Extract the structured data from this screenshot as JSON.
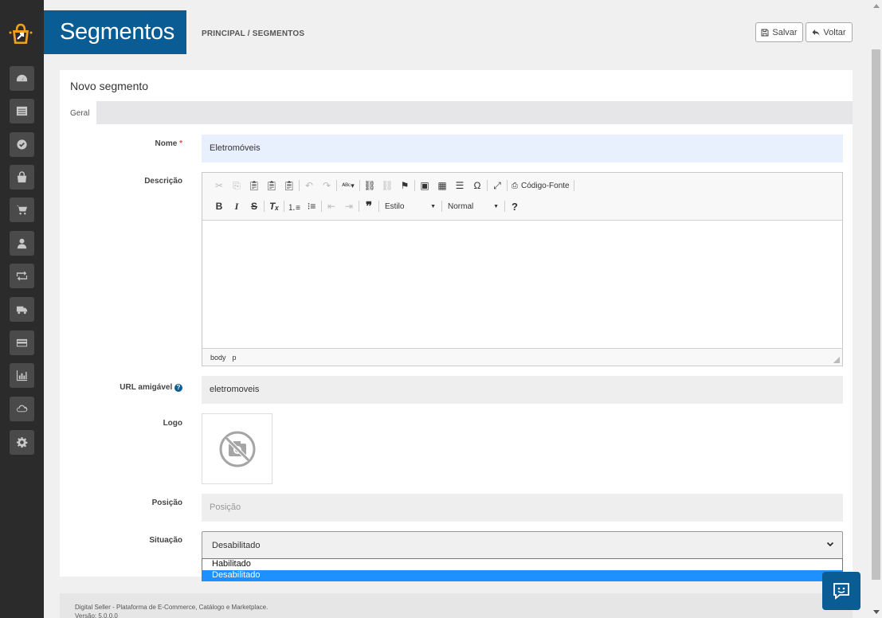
{
  "colors": {
    "brand": "#0a5d94",
    "sidebar": "#2b2b2b",
    "selected_option": "#1e90ff",
    "required": "#d9534f"
  },
  "sidebar": {
    "items": [
      {
        "icon": "dashboard-icon"
      },
      {
        "icon": "list-icon"
      },
      {
        "icon": "check-circle-icon"
      },
      {
        "icon": "shopping-bag-icon"
      },
      {
        "icon": "cart-icon"
      },
      {
        "icon": "user-icon"
      },
      {
        "icon": "retweet-icon"
      },
      {
        "icon": "truck-icon"
      },
      {
        "icon": "credit-card-icon"
      },
      {
        "icon": "bar-chart-icon"
      },
      {
        "icon": "cloud-icon"
      },
      {
        "icon": "gear-icon"
      }
    ]
  },
  "header": {
    "title": "Segmentos",
    "breadcrumb": "PRINCIPAL / SEGMENTOS",
    "save_label": "Salvar",
    "back_label": "Voltar"
  },
  "card": {
    "title": "Novo segmento",
    "tab_label": "Geral"
  },
  "form": {
    "nome": {
      "label": "Nome",
      "required_mark": "*",
      "value": "Eletromóveis"
    },
    "descricao": {
      "label": "Descrição"
    },
    "url": {
      "label": "URL amigável",
      "help": "?",
      "value": "eletromoveis"
    },
    "logo": {
      "label": "Logo"
    },
    "posicao": {
      "label": "Posição",
      "placeholder": "Posição"
    },
    "situacao": {
      "label": "Situação",
      "value": "Desabilitado",
      "options": [
        "Habilitado",
        "Desabilitado"
      ]
    }
  },
  "editor": {
    "source_label": "Código-Fonte",
    "style_combo": "Estilo",
    "format_combo": "Normal",
    "help_btn": "?",
    "path": [
      "body",
      "p"
    ]
  },
  "footer": {
    "line1": "Digital Seller - Plataforma de E-Commerce, Catálogo e Marketplace.",
    "line2": "Versão: 5.0.0.0"
  }
}
